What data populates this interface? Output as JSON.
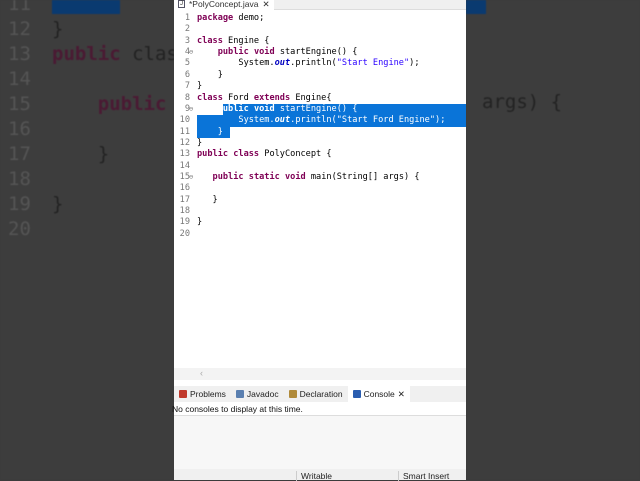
{
  "background_echo": {
    "left": [
      {
        "num": "11",
        "text": ""
      },
      {
        "num": "12",
        "text": "}"
      },
      {
        "num": "13",
        "text": "public clas",
        "kw": "public"
      },
      {
        "num": "14",
        "text": ""
      },
      {
        "num": "15",
        "text": "    public",
        "kw": "public"
      },
      {
        "num": "16",
        "text": ""
      },
      {
        "num": "17",
        "text": "    }"
      },
      {
        "num": "18",
        "text": ""
      },
      {
        "num": "19",
        "text": "}"
      },
      {
        "num": "20",
        "text": ""
      }
    ],
    "right_text": "args) {"
  },
  "editor": {
    "tab_title": "*PolyConcept.java",
    "lines": [
      {
        "n": "1",
        "tokens": [
          [
            "kw",
            "package"
          ],
          [
            "t",
            " demo;"
          ]
        ]
      },
      {
        "n": "2",
        "tokens": []
      },
      {
        "n": "3",
        "tokens": [
          [
            "kw",
            "class"
          ],
          [
            "t",
            " Engine {"
          ]
        ]
      },
      {
        "n": "4",
        "fold": true,
        "tokens": [
          [
            "t",
            "    "
          ],
          [
            "kw",
            "public"
          ],
          [
            "t",
            " "
          ],
          [
            "kw",
            "void"
          ],
          [
            "t",
            " startEngine() {"
          ]
        ]
      },
      {
        "n": "5",
        "tokens": [
          [
            "t",
            "        System."
          ],
          [
            "fld",
            "out"
          ],
          [
            "t",
            ".println("
          ],
          [
            "str",
            "\"Start Engine\""
          ],
          [
            "t",
            ");"
          ]
        ]
      },
      {
        "n": "6",
        "tokens": [
          [
            "t",
            "    }"
          ]
        ]
      },
      {
        "n": "7",
        "tokens": [
          [
            "t",
            "}"
          ]
        ]
      },
      {
        "n": "8",
        "tokens": [
          [
            "kw",
            "class"
          ],
          [
            "t",
            " Ford "
          ],
          [
            "kw",
            "extends"
          ],
          [
            "t",
            " Engine{"
          ]
        ]
      },
      {
        "n": "9",
        "fold": true,
        "sel": "part",
        "tokens": [
          [
            "t",
            "    "
          ],
          [
            "kw",
            "public"
          ],
          [
            "t",
            " "
          ],
          [
            "kw",
            "void"
          ],
          [
            "t",
            " startEngine() {"
          ]
        ]
      },
      {
        "n": "10",
        "sel": "full",
        "tokens": [
          [
            "t",
            "        System."
          ],
          [
            "fld",
            "out"
          ],
          [
            "t",
            ".println("
          ],
          [
            "str",
            "\"Start Ford Engine\""
          ],
          [
            "t",
            ");"
          ]
        ]
      },
      {
        "n": "11",
        "sel": "end",
        "tokens": [
          [
            "t",
            "    }"
          ]
        ]
      },
      {
        "n": "12",
        "tokens": [
          [
            "t",
            "}"
          ]
        ]
      },
      {
        "n": "13",
        "tokens": [
          [
            "kw",
            "public"
          ],
          [
            "t",
            " "
          ],
          [
            "kw",
            "class"
          ],
          [
            "t",
            " PolyConcept {"
          ]
        ]
      },
      {
        "n": "14",
        "tokens": []
      },
      {
        "n": "15",
        "fold": true,
        "tokens": [
          [
            "t",
            "   "
          ],
          [
            "kw",
            "public"
          ],
          [
            "t",
            " "
          ],
          [
            "kw",
            "static"
          ],
          [
            "t",
            " "
          ],
          [
            "kw",
            "void"
          ],
          [
            "t",
            " main(String[] args) {"
          ]
        ]
      },
      {
        "n": "16",
        "tokens": []
      },
      {
        "n": "17",
        "tokens": [
          [
            "t",
            "   }"
          ]
        ]
      },
      {
        "n": "18",
        "tokens": []
      },
      {
        "n": "19",
        "tokens": [
          [
            "t",
            "}"
          ]
        ]
      },
      {
        "n": "20",
        "tokens": []
      }
    ]
  },
  "views": {
    "tabs": [
      {
        "label": "Problems",
        "color": "#c0392b"
      },
      {
        "label": "Javadoc",
        "color": "#5a7fb0"
      },
      {
        "label": "Declaration",
        "color": "#b08a3a"
      },
      {
        "label": "Console",
        "color": "#2a5db0",
        "active": true
      }
    ],
    "console_message": "No consoles to display at this time."
  },
  "status": {
    "writable": "Writable",
    "insert_mode": "Smart Insert"
  },
  "colors": {
    "selection": "#0a74d8",
    "keyword": "#7f0055",
    "string": "#2a00ff"
  }
}
